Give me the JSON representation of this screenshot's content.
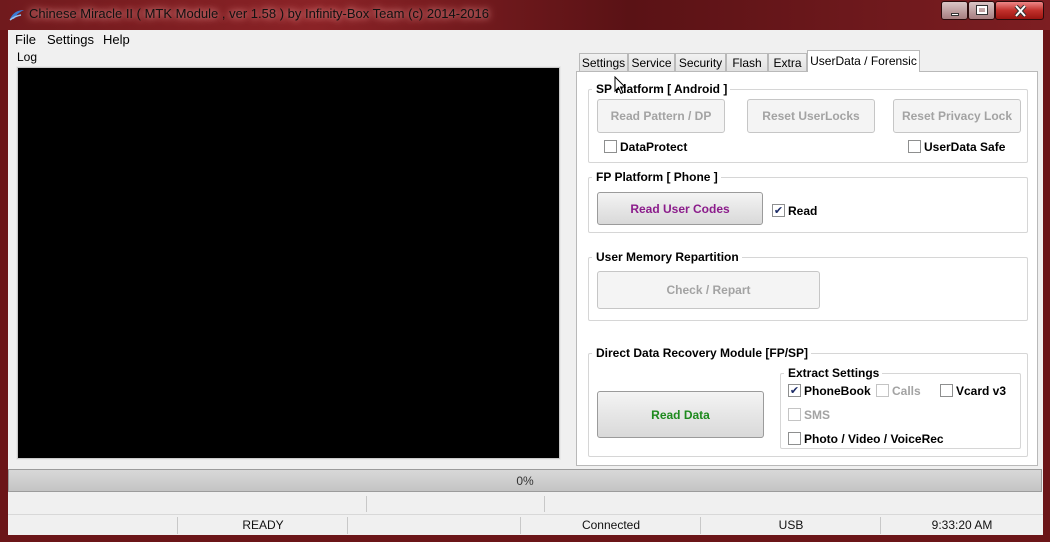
{
  "window": {
    "title": "Chinese Miracle II ( MTK Module , ver 1.58 ) by Infinity-Box Team (c) 2014-2016"
  },
  "menu": {
    "items": [
      "File",
      "Settings",
      "Help"
    ]
  },
  "log": {
    "label": "Log"
  },
  "tabs": [
    "Settings",
    "Service",
    "Security",
    "Flash",
    "Extra",
    "UserData / Forensic"
  ],
  "active_tab": "UserData / Forensic",
  "sp_platform": {
    "title": "SP Platform [ Android ]",
    "read_pattern": "Read Pattern / DP",
    "reset_userlocks": "Reset UserLocks",
    "reset_privacy": "Reset Privacy Lock",
    "dataprotect": "DataProtect",
    "userdata_safe": "UserData Safe"
  },
  "fp_platform": {
    "title": "FP Platform [ Phone ]",
    "read_user_codes": "Read User Codes",
    "read_label": "Read",
    "read_checked": true
  },
  "user_memory": {
    "title": "User Memory Repartition",
    "check_repart": "Check / Repart"
  },
  "recovery": {
    "title": "Direct Data Recovery Module  [FP/SP]",
    "read_data": "Read Data",
    "extract_title": "Extract Settings",
    "phonebook": "PhoneBook",
    "phonebook_checked": true,
    "calls": "Calls",
    "vcard": "Vcard v3",
    "sms": "SMS",
    "media": "Photo / Video / VoiceRec"
  },
  "progress": {
    "text": "0%",
    "value": 0
  },
  "status": {
    "state": "READY",
    "connection": "Connected",
    "interface": "USB",
    "time": "9:33:20 AM"
  },
  "colors": {
    "read_user_codes_text": "#8b1c8b",
    "read_data_text": "#1e8a1e"
  }
}
